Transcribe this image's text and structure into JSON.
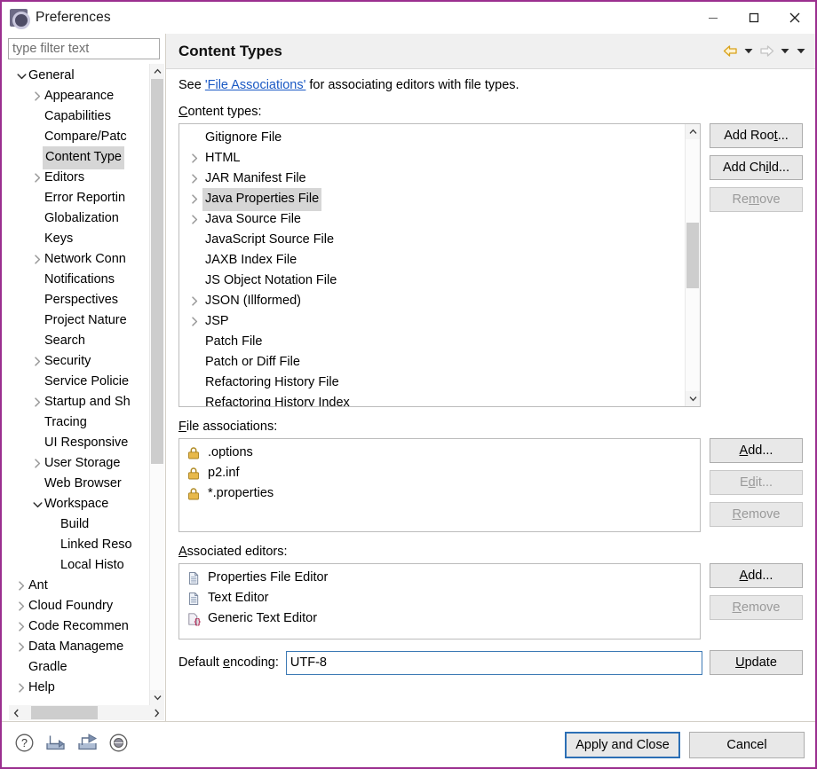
{
  "window": {
    "title": "Preferences",
    "icon": "preferences-gear-icon",
    "controls": {
      "minimize": "minimize-icon",
      "maximize": "maximize-icon",
      "close": "close-icon"
    },
    "frame_color": "#9b2f8f"
  },
  "sidebar": {
    "filter": {
      "placeholder": "type filter text",
      "value": ""
    },
    "items": [
      {
        "label": "General",
        "indent": 0,
        "twisty": "down"
      },
      {
        "label": "Appearance",
        "indent": 1,
        "twisty": "right"
      },
      {
        "label": "Capabilities",
        "indent": 1,
        "twisty": "none"
      },
      {
        "label": "Compare/Patc",
        "indent": 1,
        "twisty": "none"
      },
      {
        "label": "Content Type",
        "indent": 1,
        "twisty": "none",
        "selected": true
      },
      {
        "label": "Editors",
        "indent": 1,
        "twisty": "right"
      },
      {
        "label": "Error Reportin",
        "indent": 1,
        "twisty": "none"
      },
      {
        "label": "Globalization",
        "indent": 1,
        "twisty": "none"
      },
      {
        "label": "Keys",
        "indent": 1,
        "twisty": "none"
      },
      {
        "label": "Network Conn",
        "indent": 1,
        "twisty": "right"
      },
      {
        "label": "Notifications",
        "indent": 1,
        "twisty": "none"
      },
      {
        "label": "Perspectives",
        "indent": 1,
        "twisty": "none"
      },
      {
        "label": "Project Nature",
        "indent": 1,
        "twisty": "none"
      },
      {
        "label": "Search",
        "indent": 1,
        "twisty": "none"
      },
      {
        "label": "Security",
        "indent": 1,
        "twisty": "right"
      },
      {
        "label": "Service Policie",
        "indent": 1,
        "twisty": "none"
      },
      {
        "label": "Startup and Sh",
        "indent": 1,
        "twisty": "right"
      },
      {
        "label": "Tracing",
        "indent": 1,
        "twisty": "none"
      },
      {
        "label": "UI Responsive",
        "indent": 1,
        "twisty": "none"
      },
      {
        "label": "User Storage",
        "indent": 1,
        "twisty": "right"
      },
      {
        "label": "Web Browser",
        "indent": 1,
        "twisty": "none"
      },
      {
        "label": "Workspace",
        "indent": 1,
        "twisty": "down"
      },
      {
        "label": "Build",
        "indent": 2,
        "twisty": "none"
      },
      {
        "label": "Linked Reso",
        "indent": 2,
        "twisty": "none"
      },
      {
        "label": "Local Histo",
        "indent": 2,
        "twisty": "none"
      },
      {
        "label": "Ant",
        "indent": 0,
        "twisty": "right"
      },
      {
        "label": "Cloud Foundry",
        "indent": 0,
        "twisty": "right"
      },
      {
        "label": "Code Recommen",
        "indent": 0,
        "twisty": "right"
      },
      {
        "label": "Data Manageme",
        "indent": 0,
        "twisty": "right"
      },
      {
        "label": "Gradle",
        "indent": 0,
        "twisty": "none"
      },
      {
        "label": "Help",
        "indent": 0,
        "twisty": "right"
      }
    ]
  },
  "header": {
    "title": "Content Types",
    "nav": {
      "back": "back-arrow-icon",
      "back_menu": "chevron-down-icon",
      "forward": "forward-arrow-icon",
      "forward_menu": "chevron-down-icon",
      "view_menu": "chevron-down-icon"
    }
  },
  "main": {
    "description": {
      "prefix": "See ",
      "link": "'File Associations'",
      "suffix": " for associating editors with file types."
    },
    "content_types": {
      "label": "Content types:",
      "label_mnemonic": "C",
      "items": [
        {
          "name": "Gitignore File",
          "twisty": "none"
        },
        {
          "name": "HTML",
          "twisty": "right"
        },
        {
          "name": "JAR Manifest File",
          "twisty": "right"
        },
        {
          "name": "Java Properties File",
          "twisty": "right",
          "selected": true
        },
        {
          "name": "Java Source File",
          "twisty": "right"
        },
        {
          "name": "JavaScript Source File",
          "twisty": "none"
        },
        {
          "name": "JAXB Index File",
          "twisty": "none"
        },
        {
          "name": "JS Object Notation File",
          "twisty": "none"
        },
        {
          "name": "JSON (Illformed)",
          "twisty": "right"
        },
        {
          "name": "JSP",
          "twisty": "right"
        },
        {
          "name": "Patch File",
          "twisty": "none"
        },
        {
          "name": "Patch or Diff File",
          "twisty": "none"
        },
        {
          "name": "Refactoring History File",
          "twisty": "none"
        },
        {
          "name": "Refactoring History Index",
          "twisty": "none"
        }
      ],
      "buttons": [
        {
          "label": "Add Root...",
          "mnemonic": "t",
          "enabled": true
        },
        {
          "label": "Add Child...",
          "mnemonic": "i",
          "enabled": true
        },
        {
          "label": "Remove",
          "mnemonic": "m",
          "enabled": false
        }
      ]
    },
    "file_associations": {
      "label": "File associations:",
      "label_mnemonic": "F",
      "items": [
        {
          "name": ".options",
          "icon": "lock-icon"
        },
        {
          "name": "p2.inf",
          "icon": "lock-icon"
        },
        {
          "name": "*.properties",
          "icon": "lock-icon"
        }
      ],
      "buttons": [
        {
          "label": "Add...",
          "mnemonic": "A",
          "enabled": true
        },
        {
          "label": "Edit...",
          "mnemonic": "d",
          "enabled": false
        },
        {
          "label": "Remove",
          "mnemonic": "R",
          "enabled": false
        }
      ]
    },
    "associated_editors": {
      "label": "Associated editors:",
      "label_mnemonic": "A",
      "items": [
        {
          "name": "Properties File Editor",
          "icon": "document-icon"
        },
        {
          "name": "Text Editor",
          "icon": "document-icon"
        },
        {
          "name": "Generic Text Editor",
          "icon": "generic-text-editor-icon"
        }
      ],
      "buttons": [
        {
          "label": "Add...",
          "mnemonic": "A",
          "enabled": true
        },
        {
          "label": "Remove",
          "mnemonic": "R",
          "enabled": false
        }
      ]
    },
    "default_encoding": {
      "label": "Default encoding:",
      "label_mnemonic": "e",
      "value": "UTF-8",
      "update_button": {
        "label": "Update",
        "mnemonic": "U"
      }
    }
  },
  "footer": {
    "icons": [
      {
        "name": "help-icon"
      },
      {
        "name": "import-icon"
      },
      {
        "name": "export-icon"
      },
      {
        "name": "restore-defaults-icon"
      }
    ],
    "buttons": [
      {
        "label": "Apply and Close",
        "default": true
      },
      {
        "label": "Cancel",
        "default": false
      }
    ]
  },
  "colors": {
    "frame": "#9b2f8f",
    "link": "#1a59c4",
    "selection": "#d6d6d6",
    "default_button_border": "#2c6fb5",
    "focus_field_border": "#3d7ab5",
    "lock_icon": "#e8b94a",
    "nav_back_arrow": "#d9a21a"
  }
}
